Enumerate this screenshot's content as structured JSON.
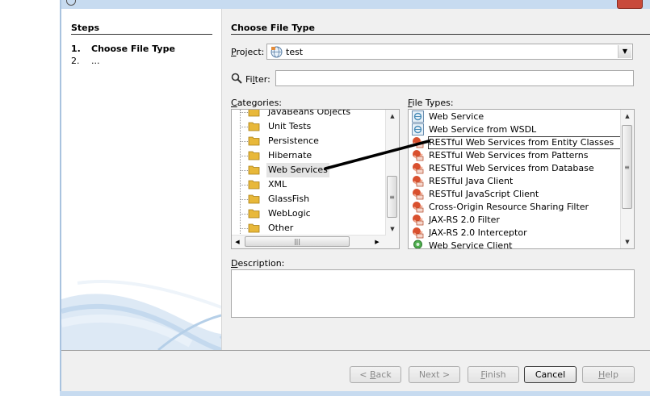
{
  "steps": {
    "title": "Steps",
    "items": [
      {
        "num": "1.",
        "label": "Choose File Type"
      },
      {
        "num": "2.",
        "label": "..."
      }
    ]
  },
  "page": {
    "heading": "Choose File Type"
  },
  "project": {
    "label_pre": "",
    "label_u": "P",
    "label_post": "roject:",
    "value": "test"
  },
  "filter": {
    "label_pre": "Fi",
    "label_u": "l",
    "label_post": "ter:",
    "value": ""
  },
  "categories": {
    "label_pre": "",
    "label_u": "C",
    "label_post": "ategories:",
    "items": [
      "JavaBeans Objects",
      "Unit Tests",
      "Persistence",
      "Hibernate",
      "Web Services",
      "XML",
      "GlassFish",
      "WebLogic",
      "Other"
    ],
    "selected": "Web Services"
  },
  "file_types": {
    "label_pre": "",
    "label_u": "F",
    "label_post": "ile Types:",
    "items": [
      {
        "label": "Web Service",
        "icon": "web-service-icon"
      },
      {
        "label": "Web Service from WSDL",
        "icon": "web-service-icon"
      },
      {
        "label": "RESTful Web Services from Entity Classes",
        "icon": "restful-icon"
      },
      {
        "label": "RESTful Web Services from Patterns",
        "icon": "restful-icon"
      },
      {
        "label": "RESTful Web Services from Database",
        "icon": "restful-icon"
      },
      {
        "label": "RESTful Java Client",
        "icon": "restful-icon"
      },
      {
        "label": "RESTful JavaScript Client",
        "icon": "restful-icon"
      },
      {
        "label": "Cross-Origin Resource Sharing Filter",
        "icon": "restful-icon"
      },
      {
        "label": "JAX-RS 2.0 Filter",
        "icon": "restful-icon"
      },
      {
        "label": "JAX-RS 2.0 Interceptor",
        "icon": "restful-icon"
      },
      {
        "label": "Web Service Client",
        "icon": "web-service-client-icon"
      }
    ],
    "selected": "RESTful Web Services from Entity Classes"
  },
  "description": {
    "label_pre": "",
    "label_u": "D",
    "label_post": "escription:",
    "value": ""
  },
  "buttons": {
    "back": {
      "pre": "< ",
      "u": "B",
      "post": "ack"
    },
    "next": {
      "pre": "Next ",
      "u": "",
      "post": ">"
    },
    "finish": {
      "pre": "",
      "u": "F",
      "post": "inish"
    },
    "cancel": {
      "pre": "Cancel",
      "u": "",
      "post": ""
    },
    "help": {
      "pre": "",
      "u": "H",
      "post": "elp"
    }
  },
  "colors": {
    "restful_icon": "#d9502e",
    "web_service_icon": "#4a8db8",
    "folder": "#e8b83a",
    "window_frame": "#c7dbf0"
  }
}
